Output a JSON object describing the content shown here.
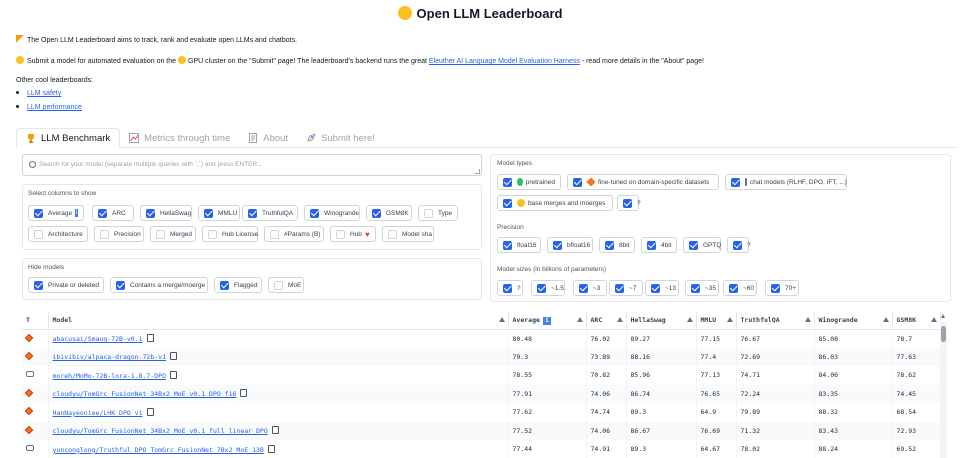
{
  "title": "Open LLM Leaderboard",
  "intro": {
    "line1": "The  Open LLM Leaderboard aims to track, rank and evaluate open LLMs and chatbots.",
    "line2_pre": "Submit a model for automated evaluation on the",
    "line2_mid": "GPU cluster on the \"Submit\" page! The leaderboard's backend runs the great",
    "line2_link": "Eleuther AI Language Model Evaluation Harness",
    "line2_post": "- read more details in the \"About\" page!",
    "other": "Other cool leaderboards:",
    "links": [
      "LLM safety",
      "LLM performance"
    ]
  },
  "tabs": [
    "LLM Benchmark",
    "Metrics through time",
    "About",
    "Submit here!"
  ],
  "search_placeholder": "Search for your model (separate multiple queries with `;`) and press ENTER...",
  "columns_section": {
    "label": "Select columns to show",
    "items": [
      {
        "label": "Average",
        "on": true,
        "info": true
      },
      {
        "label": "ARC",
        "on": true
      },
      {
        "label": "HellaSwag",
        "on": true
      },
      {
        "label": "MMLU",
        "on": true
      },
      {
        "label": "TruthfulQA",
        "on": true
      },
      {
        "label": "Winogrande",
        "on": true
      },
      {
        "label": "GSM8K",
        "on": true
      },
      {
        "label": "Type",
        "on": false
      },
      {
        "label": "Architecture",
        "on": false
      },
      {
        "label": "Precision",
        "on": false
      },
      {
        "label": "Merged",
        "on": false
      },
      {
        "label": "Hub License",
        "on": false
      },
      {
        "label": "#Params (B)",
        "on": false
      },
      {
        "label": "Hub",
        "on": false,
        "heart": true
      },
      {
        "label": "Model sha",
        "on": false
      }
    ]
  },
  "hide_section": {
    "label": "Hide models",
    "items": [
      {
        "label": "Private or deleted",
        "on": true
      },
      {
        "label": "Contains a merge/moerge",
        "on": true
      },
      {
        "label": "Flagged",
        "on": true
      },
      {
        "label": "MoE",
        "on": false
      }
    ]
  },
  "type_section": {
    "label": "Model types",
    "items": [
      {
        "label": "pretrained",
        "on": true,
        "icon": "green-circle-icon"
      },
      {
        "label": "fine-tuned on domain-specific datasets",
        "on": true,
        "icon": "orange-diamond-icon"
      },
      {
        "label": "chat models (RLHF, DPO, IFT, ...)",
        "on": true,
        "icon": "chat-bubble-icon"
      },
      {
        "label": "base merges and moerges",
        "on": true,
        "icon": "handshake-icon"
      },
      {
        "label": "?",
        "on": true
      }
    ]
  },
  "precision_section": {
    "label": "Precision",
    "items": [
      {
        "label": "float16",
        "on": true
      },
      {
        "label": "bfloat16",
        "on": true
      },
      {
        "label": "8bit",
        "on": true
      },
      {
        "label": "4bit",
        "on": true
      },
      {
        "label": "GPTQ",
        "on": true
      },
      {
        "label": "?",
        "on": true
      }
    ]
  },
  "size_section": {
    "label": "Model sizes (in billions of parameters)",
    "items": [
      "?",
      "~1.5",
      "~3",
      "~7",
      "~13",
      "~35",
      "~60",
      "70+"
    ]
  },
  "table": {
    "headers": [
      "T",
      "Model",
      "Average",
      "ARC",
      "HellaSwag",
      "MMLU",
      "TruthfulQA",
      "Winogrande",
      "GSM8K"
    ],
    "rows": [
      {
        "t": "diamond",
        "model": "abacusai/Smaug-72B-v0.1",
        "vals": [
          "80.48",
          "76.02",
          "89.27",
          "77.15",
          "76.67",
          "85.08",
          "78.7"
        ]
      },
      {
        "t": "diamond",
        "model": "ibivibiv/alpaca-dragon-72b-v1",
        "vals": [
          "79.3",
          "73.89",
          "88.16",
          "77.4",
          "72.69",
          "86.03",
          "77.63"
        ]
      },
      {
        "t": "chat",
        "model": "moreh/MoMo-72B-lora-1.8.7-DPO",
        "vals": [
          "78.55",
          "70.82",
          "85.96",
          "77.13",
          "74.71",
          "84.06",
          "78.62"
        ]
      },
      {
        "t": "diamond",
        "model": "cloudyu/TomGrc_FusionNet_34Bx2_MoE_v0.1_DPO_f16",
        "vals": [
          "77.91",
          "74.06",
          "86.74",
          "76.65",
          "72.24",
          "83.35",
          "74.45"
        ]
      },
      {
        "t": "diamond",
        "model": "HanNayeoniee/LHK_DPO_v1",
        "vals": [
          "77.62",
          "74.74",
          "89.3",
          "64.9",
          "79.89",
          "88.32",
          "68.54"
        ]
      },
      {
        "t": "diamond",
        "model": "cloudyu/TomGrc_FusionNet_34Bx2_MoE_v0.1_full_linear_DPO",
        "vals": [
          "77.52",
          "74.06",
          "86.67",
          "76.69",
          "71.32",
          "83.43",
          "72.93"
        ]
      },
      {
        "t": "chat",
        "model": "yunconglong/Truthful_DPO_TomGrc_FusionNet_7Bx2_MoE_13B",
        "vals": [
          "77.44",
          "74.91",
          "89.3",
          "64.67",
          "78.02",
          "88.24",
          "69.52"
        ]
      }
    ]
  }
}
